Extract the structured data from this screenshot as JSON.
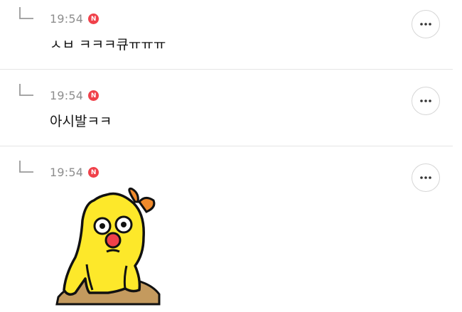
{
  "replies": [
    {
      "time": "19:54",
      "badge": "N",
      "text": "ㅅㅂ ㅋㅋㅋ큐ㅠㅠㅠ",
      "more_icon": "more-horizontal-icon"
    },
    {
      "time": "19:54",
      "badge": "N",
      "text": "아시발ㅋㅋ",
      "more_icon": "more-horizontal-icon"
    },
    {
      "time": "19:54",
      "badge": "N",
      "sticker": "yellow-chick-sticker",
      "more_icon": "more-horizontal-icon"
    }
  ],
  "colors": {
    "badge": "#f0414a",
    "time": "#8e8e8e",
    "divider": "#e4e4e4",
    "sticker_body": "#fde82a",
    "sticker_ground": "#c49a5e"
  }
}
